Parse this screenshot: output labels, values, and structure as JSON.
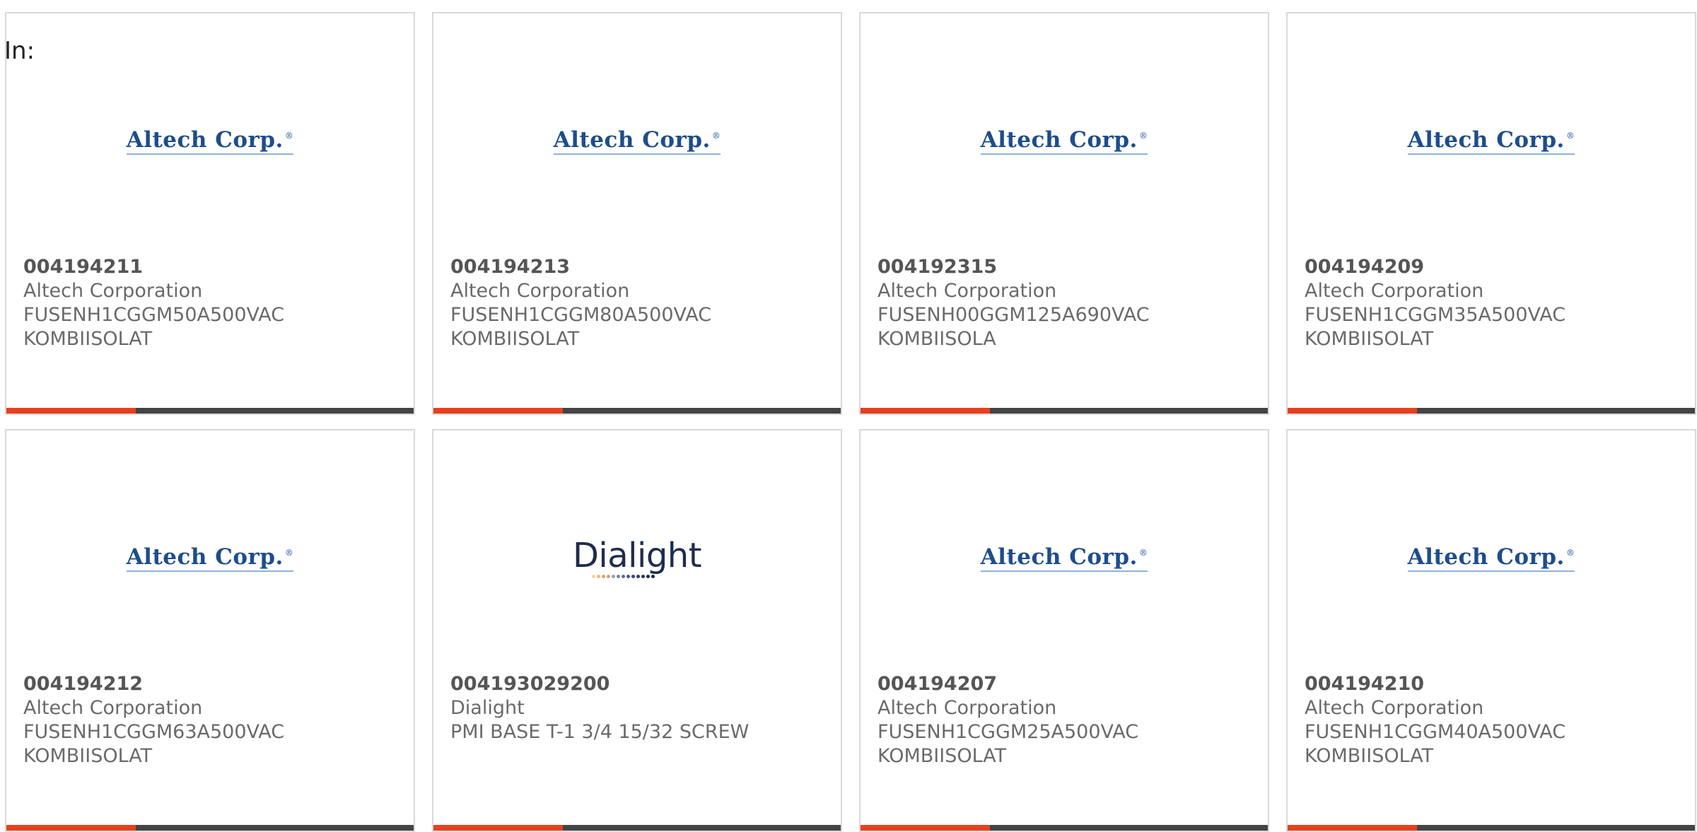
{
  "header": {
    "label": "In:"
  },
  "colors": {
    "accent": "#e8401c",
    "bar": "#444444",
    "altech_blue": "#1d4d8c",
    "dialight_navy": "#1f2d4d"
  },
  "products": [
    {
      "part_number": "004194211",
      "manufacturer": "Altech Corporation",
      "desc_line1": "FUSENH1CGGM50A500VAC",
      "desc_line2": "KOMBIISOLAT",
      "logo": "Altech Corp."
    },
    {
      "part_number": "004194213",
      "manufacturer": "Altech Corporation",
      "desc_line1": "FUSENH1CGGM80A500VAC",
      "desc_line2": "KOMBIISOLAT",
      "logo": "Altech Corp."
    },
    {
      "part_number": "004192315",
      "manufacturer": "Altech Corporation",
      "desc_line1": "FUSENH00GGM125A690VAC",
      "desc_line2": "KOMBIISOLA",
      "logo": "Altech Corp."
    },
    {
      "part_number": "004194209",
      "manufacturer": "Altech Corporation",
      "desc_line1": "FUSENH1CGGM35A500VAC",
      "desc_line2": "KOMBIISOLAT",
      "logo": "Altech Corp."
    },
    {
      "part_number": "004194212",
      "manufacturer": "Altech Corporation",
      "desc_line1": "FUSENH1CGGM63A500VAC",
      "desc_line2": "KOMBIISOLAT",
      "logo": "Altech Corp."
    },
    {
      "part_number": "004193029200",
      "manufacturer": "Dialight",
      "desc_line1": "PMI BASE T-1 3/4 15/32 SCREW",
      "desc_line2": "",
      "logo": "Dialight"
    },
    {
      "part_number": "004194207",
      "manufacturer": "Altech Corporation",
      "desc_line1": "FUSENH1CGGM25A500VAC",
      "desc_line2": "KOMBIISOLAT",
      "logo": "Altech Corp."
    },
    {
      "part_number": "004194210",
      "manufacturer": "Altech Corporation",
      "desc_line1": "FUSENH1CGGM40A500VAC",
      "desc_line2": "KOMBIISOLAT",
      "logo": "Altech Corp."
    }
  ]
}
